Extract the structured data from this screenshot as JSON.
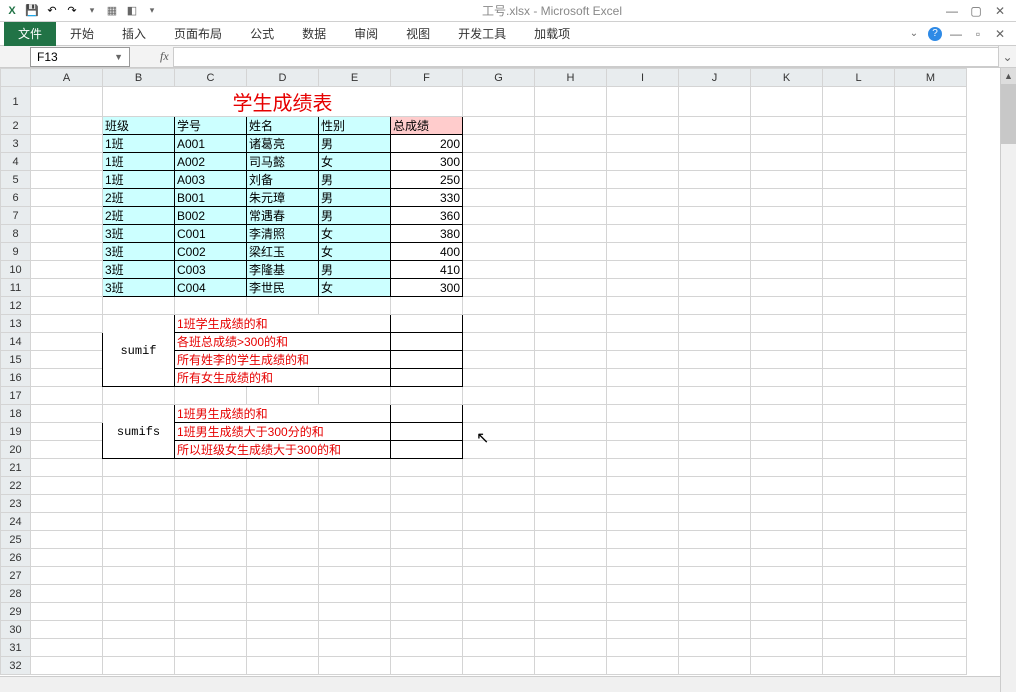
{
  "app": {
    "title": "工号.xlsx  -  Microsoft Excel"
  },
  "qat": {
    "save": "💾",
    "undo": "↶",
    "redo": "↷"
  },
  "ribbon": {
    "file": "文件",
    "tabs": [
      "开始",
      "插入",
      "页面布局",
      "公式",
      "数据",
      "审阅",
      "视图",
      "开发工具",
      "加载项"
    ]
  },
  "namebox": {
    "value": "F13"
  },
  "formula": {
    "fx": "fx",
    "value": ""
  },
  "columns": [
    "A",
    "B",
    "C",
    "D",
    "E",
    "F",
    "G",
    "H",
    "I",
    "J",
    "K",
    "L",
    "M"
  ],
  "rows_count": 32,
  "title_cell": "学生成绩表",
  "headers": {
    "class": "班级",
    "id": "学号",
    "name": "姓名",
    "gender": "性别",
    "total": "总成绩"
  },
  "students": [
    {
      "class": "1班",
      "id": "A001",
      "name": "诸葛亮",
      "gender": "男",
      "total": 200
    },
    {
      "class": "1班",
      "id": "A002",
      "name": "司马懿",
      "gender": "女",
      "total": 300
    },
    {
      "class": "1班",
      "id": "A003",
      "name": "刘备",
      "gender": "男",
      "total": 250
    },
    {
      "class": "2班",
      "id": "B001",
      "name": "朱元璋",
      "gender": "男",
      "total": 330
    },
    {
      "class": "2班",
      "id": "B002",
      "name": "常遇春",
      "gender": "男",
      "total": 360
    },
    {
      "class": "3班",
      "id": "C001",
      "name": "李清照",
      "gender": "女",
      "total": 380
    },
    {
      "class": "3班",
      "id": "C002",
      "name": "梁红玉",
      "gender": "女",
      "total": 400
    },
    {
      "class": "3班",
      "id": "C003",
      "name": "李隆基",
      "gender": "男",
      "total": 410
    },
    {
      "class": "3班",
      "id": "C004",
      "name": "李世民",
      "gender": "女",
      "total": 300
    }
  ],
  "sumif": {
    "label": "sumif",
    "rows": [
      "1班学生成绩的和",
      "各班总成绩>300的和",
      "所有姓李的学生成绩的和",
      "所有女生成绩的和"
    ]
  },
  "sumifs": {
    "label": "sumifs",
    "rows": [
      "1班男生成绩的和",
      "1班男生成绩大于300分的和",
      "所以班级女生成绩大于300的和"
    ]
  }
}
